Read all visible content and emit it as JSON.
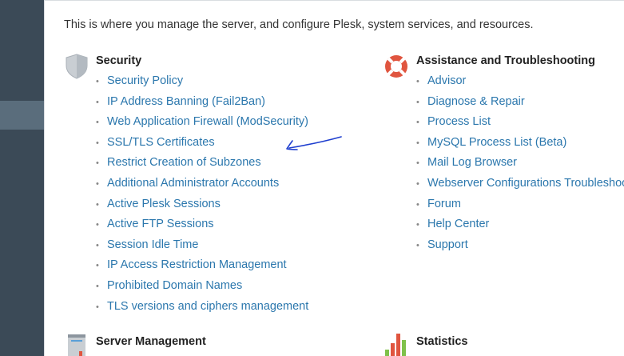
{
  "intro": "This is where you manage the server, and configure Plesk, system services, and resources.",
  "sidebar": {
    "collapse_glyph": "‹"
  },
  "security": {
    "title": "Security",
    "icon": "shield-icon",
    "items": [
      "Security Policy",
      "IP Address Banning (Fail2Ban)",
      "Web Application Firewall (ModSecurity)",
      "SSL/TLS Certificates",
      "Restrict Creation of Subzones",
      "Additional Administrator Accounts",
      "Active Plesk Sessions",
      "Active FTP Sessions",
      "Session Idle Time",
      "IP Access Restriction Management",
      "Prohibited Domain Names",
      "TLS versions and ciphers management"
    ]
  },
  "assistance": {
    "title": "Assistance and Troubleshooting",
    "icon": "lifebuoy-icon",
    "items": [
      "Advisor",
      "Diagnose & Repair",
      "Process List",
      "MySQL Process List (Beta)",
      "Mail Log Browser",
      "Webserver Configurations Troubleshooter",
      "Forum",
      "Help Center",
      "Support"
    ]
  },
  "server_management": {
    "title": "Server Management",
    "icon": "server-icon"
  },
  "statistics": {
    "title": "Statistics",
    "icon": "bar-chart-icon"
  },
  "colors": {
    "sidebar": "#3b4a57",
    "link": "#2b77ad",
    "annotation": "#1f3fcf",
    "lifebuoy": "#e0553f"
  }
}
